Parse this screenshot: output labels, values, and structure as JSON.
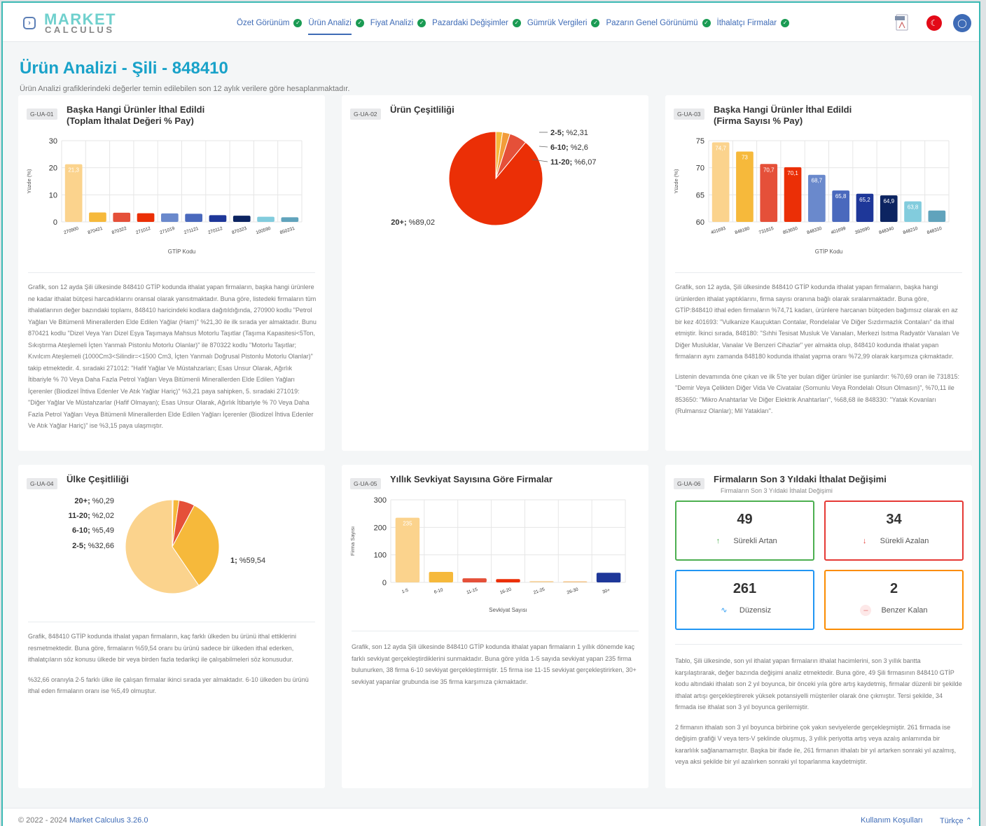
{
  "logo": {
    "line1": "MARKET",
    "line2": "CALCULUS"
  },
  "nav": [
    {
      "label": "Özet Görünüm"
    },
    {
      "label": "Ürün Analizi"
    },
    {
      "label": "Fiyat Analizi"
    },
    {
      "label": "Pazardaki Değişimler"
    },
    {
      "label": "Gümrük Vergileri"
    },
    {
      "label": "Pazarın Genel Görünümü"
    },
    {
      "label": "İthalatçı Firmalar"
    }
  ],
  "header_icons": {
    "pdf": "pdf-icon",
    "flag": "turkey-flag-icon",
    "user": "user-icon"
  },
  "page": {
    "title": "Ürün Analizi - Şili - 848410",
    "subtitle": "Ürün Analizi grafiklerindeki değerler temin edilebilen son 12 aylık verilere göre hesaplanmaktadır."
  },
  "cards": {
    "c1": {
      "tag": "G-UA-01",
      "title1": "Başka Hangi Ürünler İthal Edildi",
      "title2": "(Toplam İthalat Değeri % Pay)",
      "desc": [
        "Grafik, son 12 ayda Şili ülkesinde 848410 GTİP kodunda ithalat yapan firmaların, başka hangi ürünlere ne kadar ithalat bütçesi harcadıklarını oransal olarak yansıtmaktadır. Buna göre, listedeki firmaların tüm ithalatlarının değer bazındaki toplamı, 848410 haricindeki kodlara dağıtıldığında, 270900 kodlu \"Petrol Yağları Ve Bitümenli Minerallerden Elde Edilen Yağlar (Ham)\" %21,30 ile ilk sırada yer almaktadır. Bunu 870421 kodlu \"Dizel Veya Yarı Dizel Eşya Taşımaya Mahsus Motorlu Taşıtlar (Taşıma Kapasitesi<5Ton, Sıkıştırma Ateşlemeli İçten Yanmalı Pistonlu Motorlu Olanlar)\" ile 870322 kodlu \"Motorlu Taşıtlar; Kıvılcım Ateşlemeli (1000Cm3<Silindir=<1500 Cm3, İçten Yanmalı Doğrusal Pistonlu Motorlu Olanlar)\" takip etmektedir. 4. sıradaki 271012: \"Hafif Yağlar Ve Müstahzarları; Esas Unsur Olarak, Ağırlık İtibariyle % 70 Veya Daha Fazla Petrol Yağları Veya Bitümenli Minerallerden Elde Edilen Yağları İçerenler (Biodizel İhtiva Edenler Ve Atık Yağlar Hariç)\" %3,21 paya sahipken, 5. sıradaki 271019: \"Diğer Yağlar Ve Müstahzarlar (Hafif Olmayan); Esas Unsur Olarak, Ağırlık İtibariyle % 70 Veya Daha Fazla Petrol Yağları Veya Bitümenli Minerallerden Elde Edilen Yağları İçerenler (Biodizel İhtiva Edenler Ve Atık Yağlar Hariç)\" ise %3,15 paya ulaşmıştır."
      ]
    },
    "c2": {
      "tag": "G-UA-02",
      "title1": "Ürün Çeşitliliği"
    },
    "c3": {
      "tag": "G-UA-03",
      "title1": "Başka Hangi Ürünler İthal Edildi",
      "title2": "(Firma Sayısı % Pay)",
      "desc": [
        "Grafik, son 12 ayda, Şili ülkesinde 848410 GTİP kodunda ithalat yapan firmaların, başka hangi ürünlerden ithalat yaptıklarını, firma sayısı oranına bağlı olarak sıralanmaktadır. Buna göre, GTİP:848410 ithal eden firmaların %74,71 kadarı, ürünlere harcanan bütçeden bağımsız olarak en az bir kez 401693: \"Vulkanize Kauçuktan Contalar, Rondelalar Ve Diğer Sızdırmazlık Contaları\" da ithal etmiştir. İkinci sırada, 848180: \"Sıhhi Tesisat Musluk Ve Vanaları, Merkezi Isıtma Radyatör Vanaları Ve Diğer Musluklar, Vanalar Ve Benzeri Cihazlar\" yer almakta olup, 848410 kodunda ithalat yapan firmaların aynı zamanda 848180 kodunda ithalat yapma oranı %72,99 olarak karşımıza çıkmaktadır.",
        "Listenin devamında öne çıkan ve ilk 5'te yer bulan diğer ürünler ise şunlardır: %70,69 oran ile 731815: \"Demir Veya Çelikten Diğer Vida Ve Civatalar (Somunlu Veya Rondelalı Olsun Olmasın)\", %70,11 ile 853650: \"Mikro Anahtarlar Ve Diğer Elektrik Anahtarları\", %68,68 ile 848330: \"Yatak Kovanları (Rulmansız Olanlar); Mil Yatakları\"."
      ]
    },
    "c4": {
      "tag": "G-UA-04",
      "title1": "Ülke Çeşitliliği",
      "desc": [
        "Grafik, 848410 GTİP kodunda ithalat yapan firmaların, kaç farklı ülkeden bu ürünü ithal ettiklerini resmetmektedir. Buna göre, firmaların %59,54 oranı bu ürünü sadece bir ülkeden ithal ederken, ithalatçıların söz konusu ülkede bir veya birden fazla tedarikçi ile çalışabilmeleri söz konusudur.",
        "%32,66 oranıyla 2-5 farklı ülke ile çalışan firmalar ikinci sırada yer almaktadır. 6-10 ülkeden bu ürünü ithal eden firmaların oranı ise %5,49 olmuştur."
      ]
    },
    "c5": {
      "tag": "G-UA-05",
      "title1": "Yıllık Sevkiyat Sayısına Göre Firmalar",
      "desc": [
        "Grafik, son 12 ayda Şili ülkesinde 848410 GTİP kodunda ithalat yapan firmaların 1 yıllık dönemde kaç farklı sevkiyat gerçekleştirdiklerini sunmaktadır. Buna göre yılda 1-5 sayıda sevkiyat yapan 235 firma bulunurken, 38 firma 6-10 sevkiyat gerçekleştirmiştir. 15 firma ise 11-15 sevkiyat gerçekleştirirken, 30+ sevkiyat yapanlar grubunda ise 35 firma karşımıza çıkmaktadır."
      ]
    },
    "c6": {
      "tag": "G-UA-06",
      "title1": "Firmaların Son 3 Yıldaki İthalat Değişimi",
      "subtitle": "Firmaların Son 3 Yıldaki İthalat Değişimi",
      "stats": [
        {
          "value": "49",
          "label": "Sürekli Artan",
          "icon": "arrow-up-icon",
          "color": "#4caf50"
        },
        {
          "value": "34",
          "label": "Sürekli Azalan",
          "icon": "arrow-down-icon",
          "color": "#e53935"
        },
        {
          "value": "261",
          "label": "Düzensiz",
          "icon": "pulse-icon",
          "color": "#2196f3"
        },
        {
          "value": "2",
          "label": "Benzer Kalan",
          "icon": "minus-icon",
          "color": "#fb8c00"
        }
      ],
      "desc": [
        "Tablo, Şili ülkesinde, son yıl ithalat yapan firmaların ithalat hacimlerini, son 3 yıllık bantta karşılaştırarak, değer bazında değişimi analiz etmektedir. Buna göre, 49 Şili firmasının 848410 GTİP kodu altındaki ithalatı son 2 yıl boyunca, bir önceki yıla göre artış kaydetmiş, firmalar düzenli bir şekilde ithalat artışı gerçekleştirerek yüksek potansiyelli müşteriler olarak öne çıkmıştır. Tersi şekilde, 34 firmada ise ithalat son 3 yıl boyunca gerilemiştir.",
        "2 firmanın ithalatı son 3 yıl boyunca birbirine çok yakın seviyelerde gerçekleşmiştir. 261 firmada ise değişim grafiği V veya ters-V şeklinde oluşmuş, 3 yıllık periyotta artış veya azalış anlamında bir kararlılık sağlanamamıştır. Başka bir ifade ile, 261 firmanın ithalatı bir yıl artarken sonraki yıl azalmış, veya aksi şekilde bir yıl azalırken sonraki yıl toparlanma kaydetmiştir."
      ]
    }
  },
  "chart_data": [
    {
      "id": "G-UA-01",
      "type": "bar",
      "xlabel": "GTİP Kodu",
      "ylabel": "Yüzde (%)",
      "ylim": [
        0,
        30
      ],
      "yticks": [
        0,
        10,
        20,
        30
      ],
      "grid": true,
      "categories": [
        "270900",
        "870421",
        "870322",
        "271012",
        "271019",
        "271121",
        "270112",
        "870323",
        "100590",
        "850231"
      ],
      "values": [
        21.3,
        3.5,
        3.4,
        3.21,
        3.15,
        3.0,
        2.5,
        2.3,
        1.9,
        1.7
      ],
      "data_labels": [
        "21,3",
        "",
        "",
        "",
        "",
        "",
        "",
        "",
        "",
        ""
      ],
      "colors": [
        "#fbd38d",
        "#f6b93b",
        "#e55039",
        "#eb2f06",
        "#6a89cc",
        "#4a69bd",
        "#1e3799",
        "#0c2461",
        "#82ccdd",
        "#60a3bc"
      ]
    },
    {
      "id": "G-UA-02",
      "type": "pie",
      "labels": [
        "2-5",
        "6-10",
        "11-20",
        "20+"
      ],
      "label_values": [
        "%2,31",
        "%2,6",
        "%6,07",
        "%89,02"
      ],
      "values": [
        2.31,
        2.6,
        6.07,
        89.02
      ],
      "colors": [
        "#f6b93b",
        "#f29c3a",
        "#e55039",
        "#eb2f06"
      ]
    },
    {
      "id": "G-UA-03",
      "type": "bar",
      "xlabel": "GTİP Kodu",
      "ylabel": "Yüzde (%)",
      "ylim": [
        60,
        75
      ],
      "yticks": [
        60,
        65,
        70,
        75
      ],
      "grid": true,
      "categories": [
        "401693",
        "848180",
        "731815",
        "853650",
        "848330",
        "401699",
        "392690",
        "848340",
        "848210",
        "848310"
      ],
      "values": [
        74.7,
        73.0,
        70.7,
        70.1,
        68.7,
        65.8,
        65.2,
        64.9,
        63.8,
        62.1
      ],
      "data_labels": [
        "74,7",
        "73",
        "70,7",
        "70,1",
        "68,7",
        "65,8",
        "65,2",
        "64,9",
        "63,8",
        ""
      ],
      "colors": [
        "#fbd38d",
        "#f6b93b",
        "#e55039",
        "#eb2f06",
        "#6a89cc",
        "#4a69bd",
        "#1e3799",
        "#0c2461",
        "#82ccdd",
        "#60a3bc"
      ]
    },
    {
      "id": "G-UA-04",
      "type": "pie",
      "labels": [
        "20+",
        "11-20",
        "6-10",
        "2-5",
        "1"
      ],
      "label_values": [
        "%0,29",
        "%2,02",
        "%5,49",
        "%32,66",
        "%59,54"
      ],
      "values": [
        0.29,
        2.02,
        5.49,
        32.66,
        59.54
      ],
      "colors": [
        "#0c2461",
        "#f6b93b",
        "#e55039",
        "#f6b93b",
        "#fbd38d"
      ]
    },
    {
      "id": "G-UA-05",
      "type": "bar",
      "xlabel": "Sevkiyat Sayısı",
      "ylabel": "Firma Sayısı",
      "ylim": [
        0,
        300
      ],
      "yticks": [
        0,
        100,
        200,
        300
      ],
      "grid": true,
      "categories": [
        "1-5",
        "6-10",
        "11-15",
        "16-20",
        "21-25",
        "26-30",
        "30+"
      ],
      "values": [
        235,
        38,
        15,
        12,
        5,
        4,
        35
      ],
      "data_labels": [
        "235",
        "",
        "",
        "",
        "",
        "",
        ""
      ],
      "colors": [
        "#fbd38d",
        "#f6b93b",
        "#e55039",
        "#eb2f06",
        "#f6d7a7",
        "#f3c78f",
        "#1e3799"
      ]
    }
  ],
  "footer": {
    "copyright": "© 2022 - 2024",
    "brand": "Market Calculus 3.26.0",
    "terms": "Kullanım Koşulları",
    "language": "Türkçe"
  }
}
